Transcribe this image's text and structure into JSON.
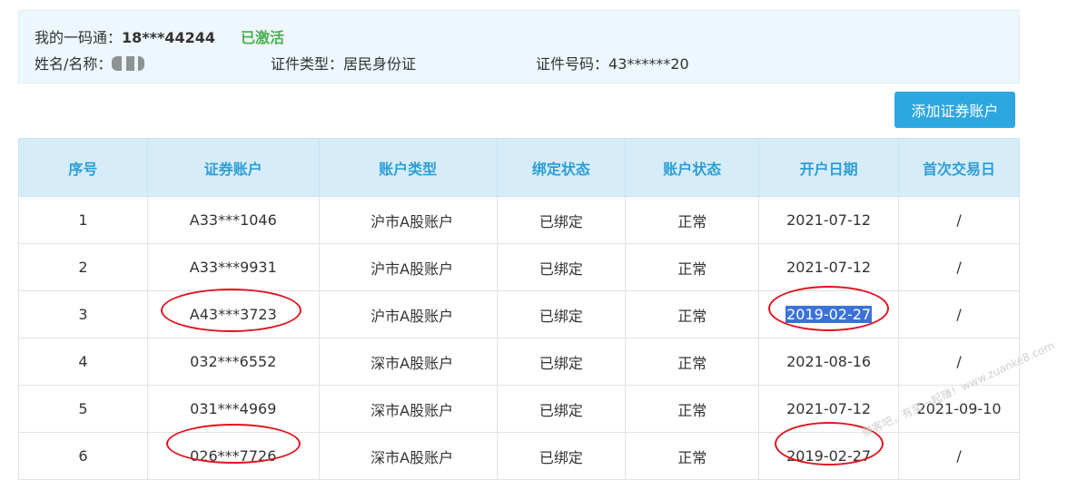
{
  "info": {
    "phone_label": "我的一码通：",
    "phone_value": "18***44244",
    "status": "已激活",
    "name_label": "姓名/名称：",
    "id_type_label": "证件类型：",
    "id_type_value": "居民身份证",
    "id_number_label": "证件号码：",
    "id_number_value": "43******20"
  },
  "add_button": "添加证券账户",
  "table": {
    "headers": [
      "序号",
      "证券账户",
      "账户类型",
      "绑定状态",
      "账户状态",
      "开户日期",
      "首次交易日"
    ],
    "rows": [
      {
        "no": "1",
        "account": "A33***1046",
        "type": "沪市A股账户",
        "bind": "已绑定",
        "status": "正常",
        "open_date": "2021-07-12",
        "first_trade": "/"
      },
      {
        "no": "2",
        "account": "A33***9931",
        "type": "沪市A股账户",
        "bind": "已绑定",
        "status": "正常",
        "open_date": "2021-07-12",
        "first_trade": "/"
      },
      {
        "no": "3",
        "account": "A43***3723",
        "type": "沪市A股账户",
        "bind": "已绑定",
        "status": "正常",
        "open_date": "2019-02-27",
        "first_trade": "/"
      },
      {
        "no": "4",
        "account": "032***6552",
        "type": "深市A股账户",
        "bind": "已绑定",
        "status": "正常",
        "open_date": "2021-08-16",
        "first_trade": "/"
      },
      {
        "no": "5",
        "account": "031***4969",
        "type": "深市A股账户",
        "bind": "已绑定",
        "status": "正常",
        "open_date": "2021-07-12",
        "first_trade": "2021-09-10"
      },
      {
        "no": "6",
        "account": "026***7726",
        "type": "深市A股账户",
        "bind": "已绑定",
        "status": "正常",
        "open_date": "2019-02-27",
        "first_trade": "/"
      }
    ]
  },
  "watermark": "赚客吧，有奖一起赚！www.zuanke8.com",
  "colors": {
    "accent": "#2ea7e0",
    "active_green": "#4caf50",
    "annotation_red": "#e0141e",
    "header_bg": "#d6ecf9"
  }
}
